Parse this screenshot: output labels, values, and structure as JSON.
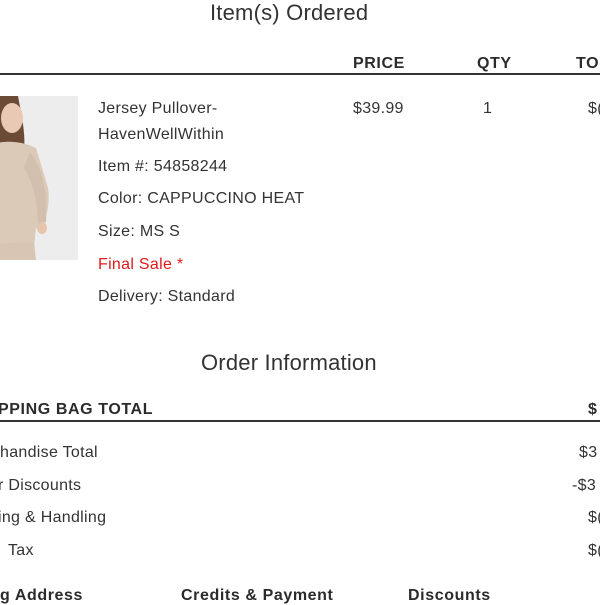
{
  "items_section": {
    "title": "Item(s) Ordered",
    "columns": {
      "price": "PRICE",
      "qty": "QTY",
      "total": "TO"
    },
    "item": {
      "name_line1": "Jersey Pullover-",
      "name_line2": "HavenWellWithin",
      "item_number": "Item #: 54858244",
      "color": "Color: CAPPUCCINO HEAT",
      "size": "Size: MS S",
      "final_sale": "Final Sale *",
      "delivery": "Delivery: Standard",
      "price": "$39.99",
      "qty": "1",
      "total_partial": "$("
    }
  },
  "order_info": {
    "title": "Order Information",
    "bag_total_label": "PPING BAG TOTAL",
    "bag_total_value": "$",
    "rows": [
      {
        "label": "handise Total",
        "value": "$3"
      },
      {
        "label": "r Discounts",
        "value": "-$3"
      },
      {
        "label": "ing & Handling",
        "value": "$("
      },
      {
        "label": "Tax",
        "value": "$("
      }
    ]
  },
  "bottom_headers": {
    "address": "g Address",
    "credits": "Credits & Payment",
    "discounts": "Discounts"
  },
  "colors": {
    "sale_red": "#e01a1a",
    "rule": "#333333"
  }
}
